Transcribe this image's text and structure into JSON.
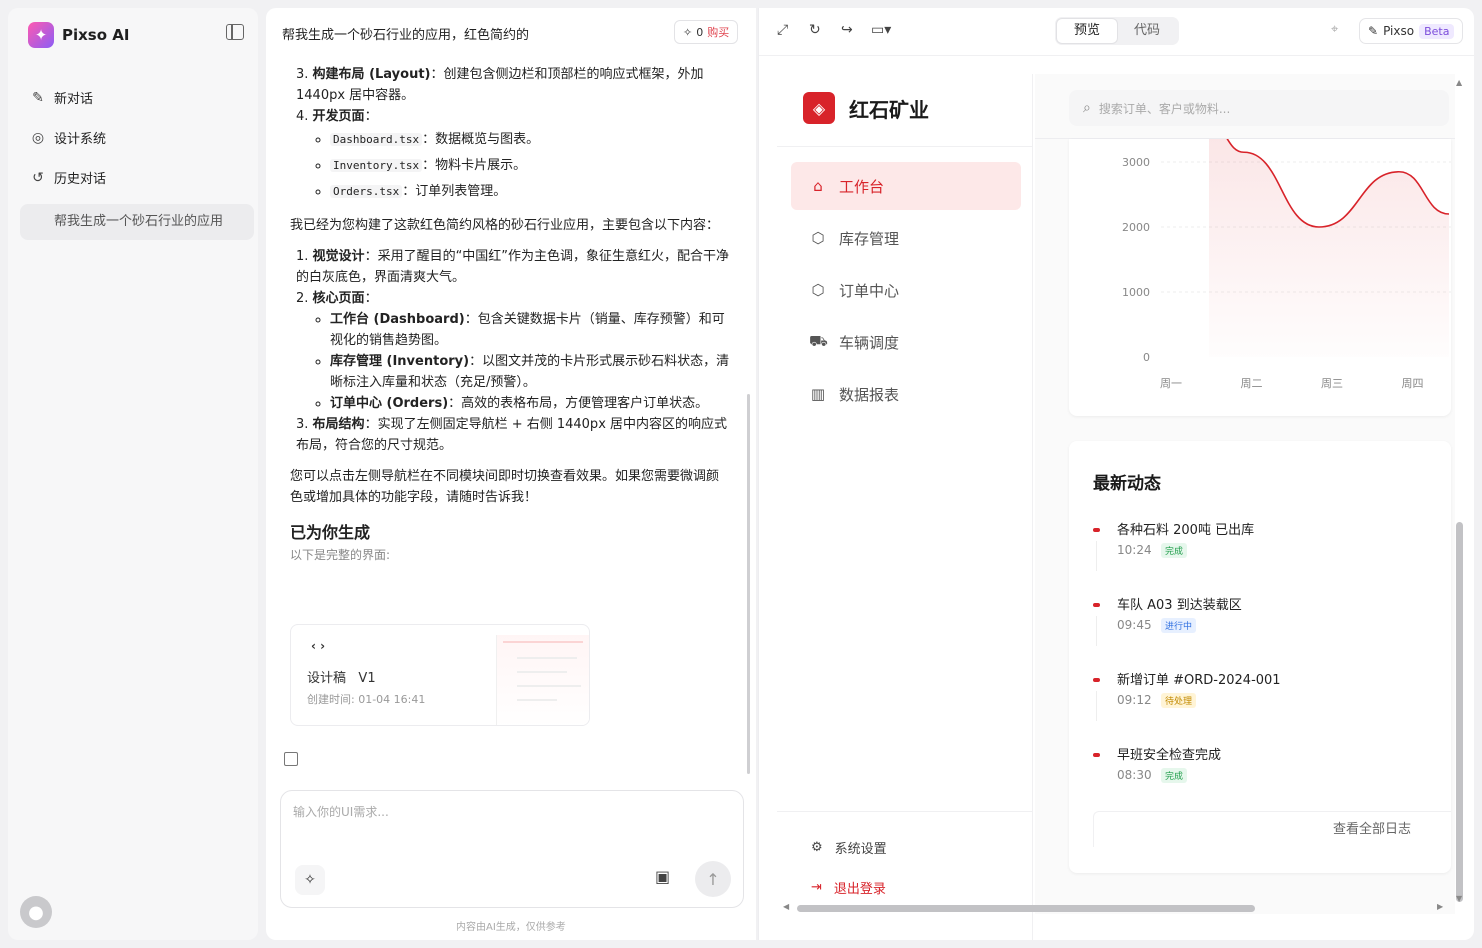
{
  "app": {
    "name": "Pixso AI"
  },
  "sidebar": {
    "items": [
      {
        "label": "新对话",
        "icon": "edit-icon"
      },
      {
        "label": "设计系统",
        "icon": "palette-icon"
      },
      {
        "label": "历史对话",
        "icon": "history-icon"
      }
    ],
    "history": [
      "帮我生成一个砂石行业的应用"
    ]
  },
  "chat": {
    "title": "帮我生成一个砂石行业的应用，红色简约的",
    "credits": "0",
    "buy_label": "购买",
    "plan_list": [
      {
        "num": "3.",
        "bold": "构建布局 (Layout)",
        "text": "：创建包含侧边栏和顶部栏的响应式框架，外加 1440px 居中容器。"
      },
      {
        "num": "4.",
        "bold": "开发页面",
        "text": "："
      }
    ],
    "plan_pages": [
      {
        "file": "Dashboard.tsx",
        "text": "：数据概览与图表。"
      },
      {
        "file": "Inventory.tsx",
        "text": "：物料卡片展示。"
      },
      {
        "file": "Orders.tsx",
        "text": "：订单列表管理。"
      }
    ],
    "intro": "我已经为您构建了这款红色简约风格的砂石行业应用，主要包含以下内容：",
    "summary": [
      {
        "num": "1.",
        "bold": "视觉设计",
        "text": "：采用了醒目的“中国红”作为主色调，象征生意红火，配合干净的白灰底色，界面清爽大气。"
      },
      {
        "num": "2.",
        "bold": "核心页面",
        "text": "："
      }
    ],
    "core_pages": [
      {
        "bold": "工作台 (Dashboard)",
        "text": "：包含关键数据卡片（销量、库存预警）和可视化的销售趋势图。"
      },
      {
        "bold": "库存管理 (Inventory)",
        "text": "：以图文并茂的卡片形式展示砂石料状态，清晰标注入库量和状态（充足/预警）。"
      },
      {
        "bold": "订单中心 (Orders)",
        "text": "：高效的表格布局，方便管理客户订单状态。"
      }
    ],
    "summary_last": {
      "num": "3.",
      "bold": "布局结构",
      "text": "：实现了左侧固定导航栏 + 右侧 1440px 居中内容区的响应式布局，符合您的尺寸规范。"
    },
    "closing": "您可以点击左侧导航栏在不同模块间即时切换查看效果。如果您需要微调颜色或增加具体的功能字段，请随时告诉我！",
    "generated_title": "已为你生成",
    "generated_sub": "以下是完整的界面:",
    "card": {
      "code_icon": "‹ ›",
      "name": "设计稿",
      "version": "V1",
      "created_label": "创建时间:",
      "created": "01-04 16:41"
    },
    "input_placeholder": "输入你的UI需求...",
    "disclaimer": "内容由AI生成，仅供参考"
  },
  "preview": {
    "tabs": [
      "预览",
      "代码"
    ],
    "active_tab": "预览",
    "badge": "Pixso",
    "beta": "Beta",
    "app": {
      "brand": "红石矿业",
      "search_placeholder": "搜索订单、客户或物料...",
      "nav": [
        {
          "label": "工作台",
          "icon": "home-icon",
          "active": true
        },
        {
          "label": "库存管理",
          "icon": "box-icon",
          "active": false
        },
        {
          "label": "订单中心",
          "icon": "package-icon",
          "active": false
        },
        {
          "label": "车辆调度",
          "icon": "truck-icon",
          "active": false
        },
        {
          "label": "数据报表",
          "icon": "bar-chart-icon",
          "active": false
        }
      ],
      "footer": [
        {
          "label": "系统设置",
          "icon": "settings-icon"
        },
        {
          "label": "退出登录",
          "icon": "logout-icon"
        }
      ],
      "activity": {
        "title": "最新动态",
        "items": [
          {
            "text": "各种石料 200吨 已出库",
            "time": "10:24",
            "status": "完成",
            "kind": "done"
          },
          {
            "text": "车队 A03 到达装载区",
            "time": "09:45",
            "status": "进行中",
            "kind": "prog"
          },
          {
            "text": "新增订单 #ORD-2024-001",
            "time": "09:12",
            "status": "待处理",
            "kind": "pend"
          },
          {
            "text": "早班安全检查完成",
            "time": "08:30",
            "status": "完成",
            "kind": "done"
          }
        ],
        "view_all": "查看全部日志"
      }
    }
  },
  "chart_data": {
    "type": "area",
    "x": [
      "周一",
      "周二",
      "周三",
      "周四"
    ],
    "series": [
      {
        "values": [
          3600,
          3150,
          2000,
          2850,
          2200
        ]
      }
    ],
    "x_positions": [
      0,
      1,
      2,
      3,
      4
    ],
    "yticks": [
      0,
      1000,
      2000,
      3000
    ],
    "ylim": [
      0,
      3300
    ],
    "color": "#d8232a",
    "grid": true
  },
  "colors": {
    "brand_red": "#d8232a",
    "active_bg": "#fde8e8"
  }
}
